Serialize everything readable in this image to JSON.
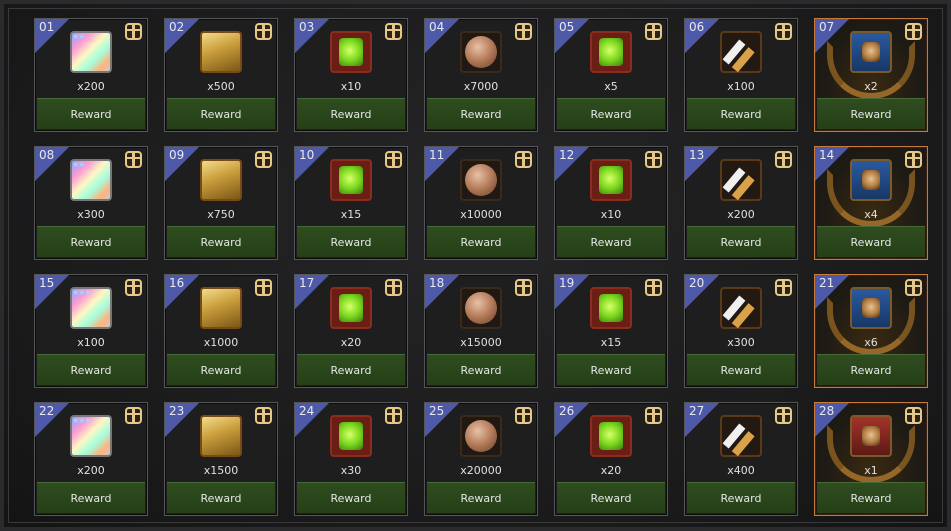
{
  "reward_button_label": "Reward",
  "colors": {
    "accent": "#4e5aa8",
    "reward_button": "#2f4d1f",
    "special_border": "#c67a3a"
  },
  "items": [
    {
      "num": "01",
      "icon": "crystal-pile-icon",
      "type": "crystal",
      "stars": "★★",
      "qty": "x200",
      "special": false
    },
    {
      "num": "02",
      "icon": "gold-pile-icon",
      "type": "gold",
      "qty": "x500",
      "special": false
    },
    {
      "num": "03",
      "icon": "green-scroll-icon",
      "type": "scroll",
      "qty": "x10",
      "special": false
    },
    {
      "num": "04",
      "icon": "bronze-coin-icon",
      "type": "coin",
      "qty": "x7000",
      "special": false
    },
    {
      "num": "05",
      "icon": "green-scroll-icon",
      "type": "scroll",
      "qty": "x5",
      "special": false
    },
    {
      "num": "06",
      "icon": "crossed-hammers-icon",
      "type": "hammer",
      "qty": "x100",
      "special": false
    },
    {
      "num": "07",
      "icon": "blue-monster-card-icon",
      "type": "card-blue",
      "qty": "x2",
      "special": true
    },
    {
      "num": "08",
      "icon": "crystal-pile-icon",
      "type": "crystal",
      "stars": "★★",
      "qty": "x300",
      "special": false
    },
    {
      "num": "09",
      "icon": "gold-pile-icon",
      "type": "gold",
      "qty": "x750",
      "special": false
    },
    {
      "num": "10",
      "icon": "green-scroll-icon",
      "type": "scroll",
      "qty": "x15",
      "special": false
    },
    {
      "num": "11",
      "icon": "bronze-coin-icon",
      "type": "coin",
      "qty": "x10000",
      "special": false
    },
    {
      "num": "12",
      "icon": "green-scroll-icon",
      "type": "scroll",
      "qty": "x10",
      "special": false
    },
    {
      "num": "13",
      "icon": "crossed-hammers-icon",
      "type": "hammer",
      "qty": "x200",
      "special": false
    },
    {
      "num": "14",
      "icon": "blue-monster-card-icon",
      "type": "card-blue",
      "qty": "x4",
      "special": true
    },
    {
      "num": "15",
      "icon": "crystal-pile-icon",
      "type": "crystal",
      "stars": "★★★",
      "qty": "x100",
      "special": false
    },
    {
      "num": "16",
      "icon": "gold-pile-icon",
      "type": "gold",
      "qty": "x1000",
      "special": false
    },
    {
      "num": "17",
      "icon": "green-scroll-icon",
      "type": "scroll",
      "qty": "x20",
      "special": false
    },
    {
      "num": "18",
      "icon": "bronze-coin-icon",
      "type": "coin",
      "qty": "x15000",
      "special": false
    },
    {
      "num": "19",
      "icon": "green-scroll-icon",
      "type": "scroll",
      "qty": "x15",
      "special": false
    },
    {
      "num": "20",
      "icon": "crossed-hammers-icon",
      "type": "hammer",
      "qty": "x300",
      "special": false
    },
    {
      "num": "21",
      "icon": "blue-monster-card-icon",
      "type": "card-blue",
      "qty": "x6",
      "special": true
    },
    {
      "num": "22",
      "icon": "crystal-pile-icon",
      "type": "crystal",
      "stars": "★★★",
      "qty": "x200",
      "special": false
    },
    {
      "num": "23",
      "icon": "gold-pile-icon",
      "type": "gold",
      "qty": "x1500",
      "special": false
    },
    {
      "num": "24",
      "icon": "green-scroll-icon",
      "type": "scroll",
      "qty": "x30",
      "special": false
    },
    {
      "num": "25",
      "icon": "bronze-coin-icon",
      "type": "coin",
      "qty": "x20000",
      "special": false
    },
    {
      "num": "26",
      "icon": "green-scroll-icon",
      "type": "scroll",
      "qty": "x20",
      "special": false
    },
    {
      "num": "27",
      "icon": "crossed-hammers-icon",
      "type": "hammer",
      "qty": "x400",
      "special": false
    },
    {
      "num": "28",
      "icon": "red-monster-card-icon",
      "type": "card-red",
      "qty": "x1",
      "special": true
    }
  ]
}
